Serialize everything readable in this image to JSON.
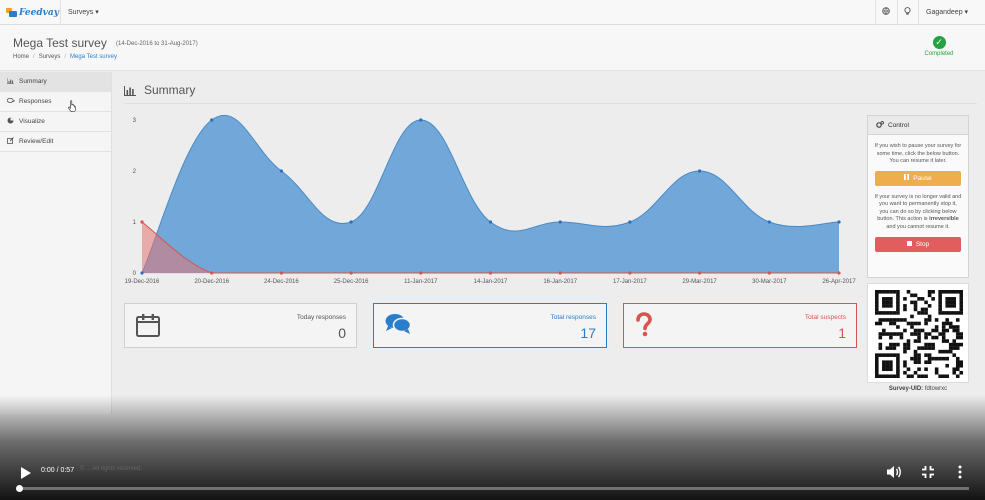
{
  "app": {
    "logo_text": "Feedvay",
    "nav_surveys": "Surveys ▾",
    "user_menu": "Gagandeep ▾"
  },
  "header": {
    "title": "Mega Test survey",
    "dates": "(14-Dec-2016 to 31-Aug-2017)",
    "breadcrumb": [
      "Home",
      "Surveys",
      "Mega Test survey"
    ],
    "status": "Completed",
    "status_color": "#26a241"
  },
  "sidebar": {
    "items": [
      {
        "label": "Summary",
        "icon": "bar-chart-icon"
      },
      {
        "label": "Responses",
        "icon": "comments-icon"
      },
      {
        "label": "Visualize",
        "icon": "pie-chart-icon"
      },
      {
        "label": "Review/Edit",
        "icon": "edit-icon"
      }
    ]
  },
  "summary": {
    "title": "Summary"
  },
  "chart_data": {
    "type": "area",
    "categories": [
      "19-Dec-2016",
      "20-Dec-2016",
      "24-Dec-2016",
      "25-Dec-2016",
      "11-Jan-2017",
      "14-Jan-2017",
      "16-Jan-2017",
      "17-Jan-2017",
      "29-Mar-2017",
      "30-Mar-2017",
      "26-Apr-2017"
    ],
    "series": [
      {
        "values": [
          0,
          3,
          2,
          1,
          3,
          1,
          1,
          1,
          2,
          1,
          1
        ],
        "color": "#5b9bd5"
      },
      {
        "values": [
          1,
          0,
          0,
          0,
          0,
          0,
          0,
          0,
          0,
          0,
          0
        ],
        "color": "#e57373"
      }
    ],
    "yticks": [
      "0",
      "1",
      "2",
      "3"
    ],
    "ylim": [
      0,
      3
    ],
    "grid": false
  },
  "cards": [
    {
      "label": "Today responses",
      "value": "0",
      "icon": "calendar-icon",
      "color": "#555555",
      "border": "#d0d0d0"
    },
    {
      "label": "Total responses",
      "value": "17",
      "icon": "comments-icon",
      "color": "#2a7dc8",
      "border": "#2a7dc8"
    },
    {
      "label": "Total suspects",
      "value": "1",
      "icon": "question-icon",
      "color": "#d9534f",
      "border": "#d9534f"
    }
  ],
  "control": {
    "title": "Control",
    "pause_text": "If you wish to pause your survey for some time, click the below button. You can resume it later.",
    "pause_label": "Pause",
    "stop_text_1": "If your survey is no longer valid and you want to permanently stop it, you can do so by clicking below button. This action is",
    "stop_text_bold": "irreversible",
    "stop_text_2": "and you cannot resume it.",
    "stop_label": "Stop",
    "pause_color": "#f0ad4e",
    "stop_color": "#e25d5d"
  },
  "qr": {
    "caption_label": "Survey-UID:",
    "uid": "fdtowrxc"
  },
  "footer": {
    "text": "© ... All rights reserved."
  },
  "video": {
    "time": "0:00 / 0:57",
    "progress": 0.0
  }
}
